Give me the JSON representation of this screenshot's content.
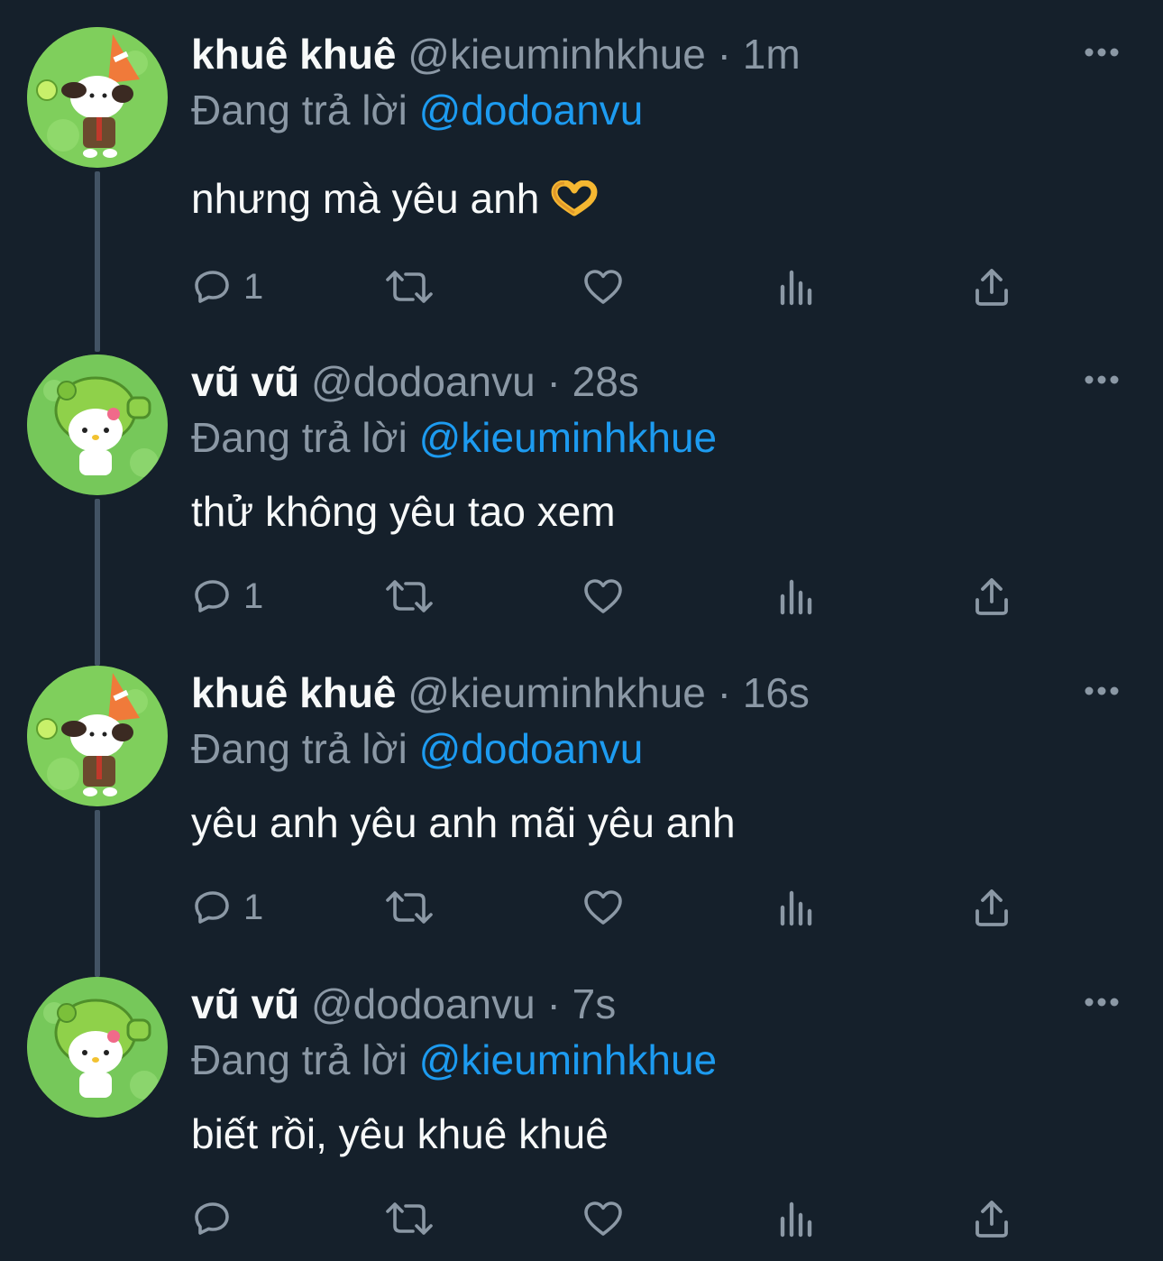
{
  "colors": {
    "background": "#15202b",
    "text_primary": "#f7f9f9",
    "text_secondary": "#8b98a5",
    "accent": "#1d9bf0",
    "thread_line": "#425364"
  },
  "tweets": [
    {
      "display_name": "khuê khuê",
      "handle": "@kieuminhkhue",
      "separator": "·",
      "time": "1m",
      "reply_prefix": "Đang trả lời",
      "reply_to": "@dodoanvu",
      "text": "nhưng mà yêu anh",
      "emoji": "heart-hands-emoji",
      "reply_count": "1",
      "avatar": "pochacco-avatar"
    },
    {
      "display_name": "vũ vũ",
      "handle": "@dodoanvu",
      "separator": "·",
      "time": "28s",
      "reply_prefix": "Đang trả lời",
      "reply_to": "@kieuminhkhue",
      "text": "thử không yêu tao xem",
      "reply_count": "1",
      "avatar": "hello-kitty-avatar"
    },
    {
      "display_name": "khuê khuê",
      "handle": "@kieuminhkhue",
      "separator": "·",
      "time": "16s",
      "reply_prefix": "Đang trả lời",
      "reply_to": "@dodoanvu",
      "text": "yêu anh yêu anh mãi yêu anh",
      "reply_count": "1",
      "avatar": "pochacco-avatar"
    },
    {
      "display_name": "vũ vũ",
      "handle": "@dodoanvu",
      "separator": "·",
      "time": "7s",
      "reply_prefix": "Đang trả lời",
      "reply_to": "@kieuminhkhue",
      "text": "biết rồi, yêu khuê khuê",
      "reply_count": "",
      "avatar": "hello-kitty-avatar"
    }
  ]
}
